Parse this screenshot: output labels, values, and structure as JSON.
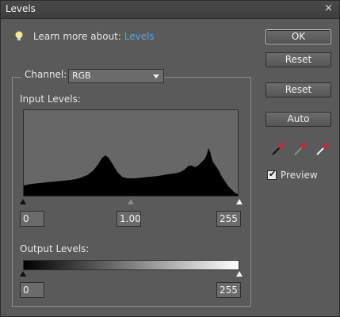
{
  "window": {
    "title": "Levels",
    "close_glyph": "×"
  },
  "help": {
    "prefix": "Learn more about:",
    "link": "Levels"
  },
  "buttons": {
    "ok": "OK",
    "reset1": "Reset",
    "reset2": "Reset",
    "auto": "Auto"
  },
  "channel": {
    "label": "Channel:",
    "selected": "RGB"
  },
  "input_levels": {
    "label": "Input Levels:",
    "black": "0",
    "gamma": "1.00",
    "white": "255"
  },
  "output_levels": {
    "label": "Output Levels:",
    "black": "0",
    "white": "255"
  },
  "preview": {
    "label": "Preview",
    "checked": true
  },
  "eyedroppers": [
    "black-point-eyedropper-icon",
    "gray-point-eyedropper-icon",
    "white-point-eyedropper-icon"
  ],
  "colors": {
    "accent_link": "#5aa0e8",
    "dialog_bg": "#5a5a5a"
  }
}
